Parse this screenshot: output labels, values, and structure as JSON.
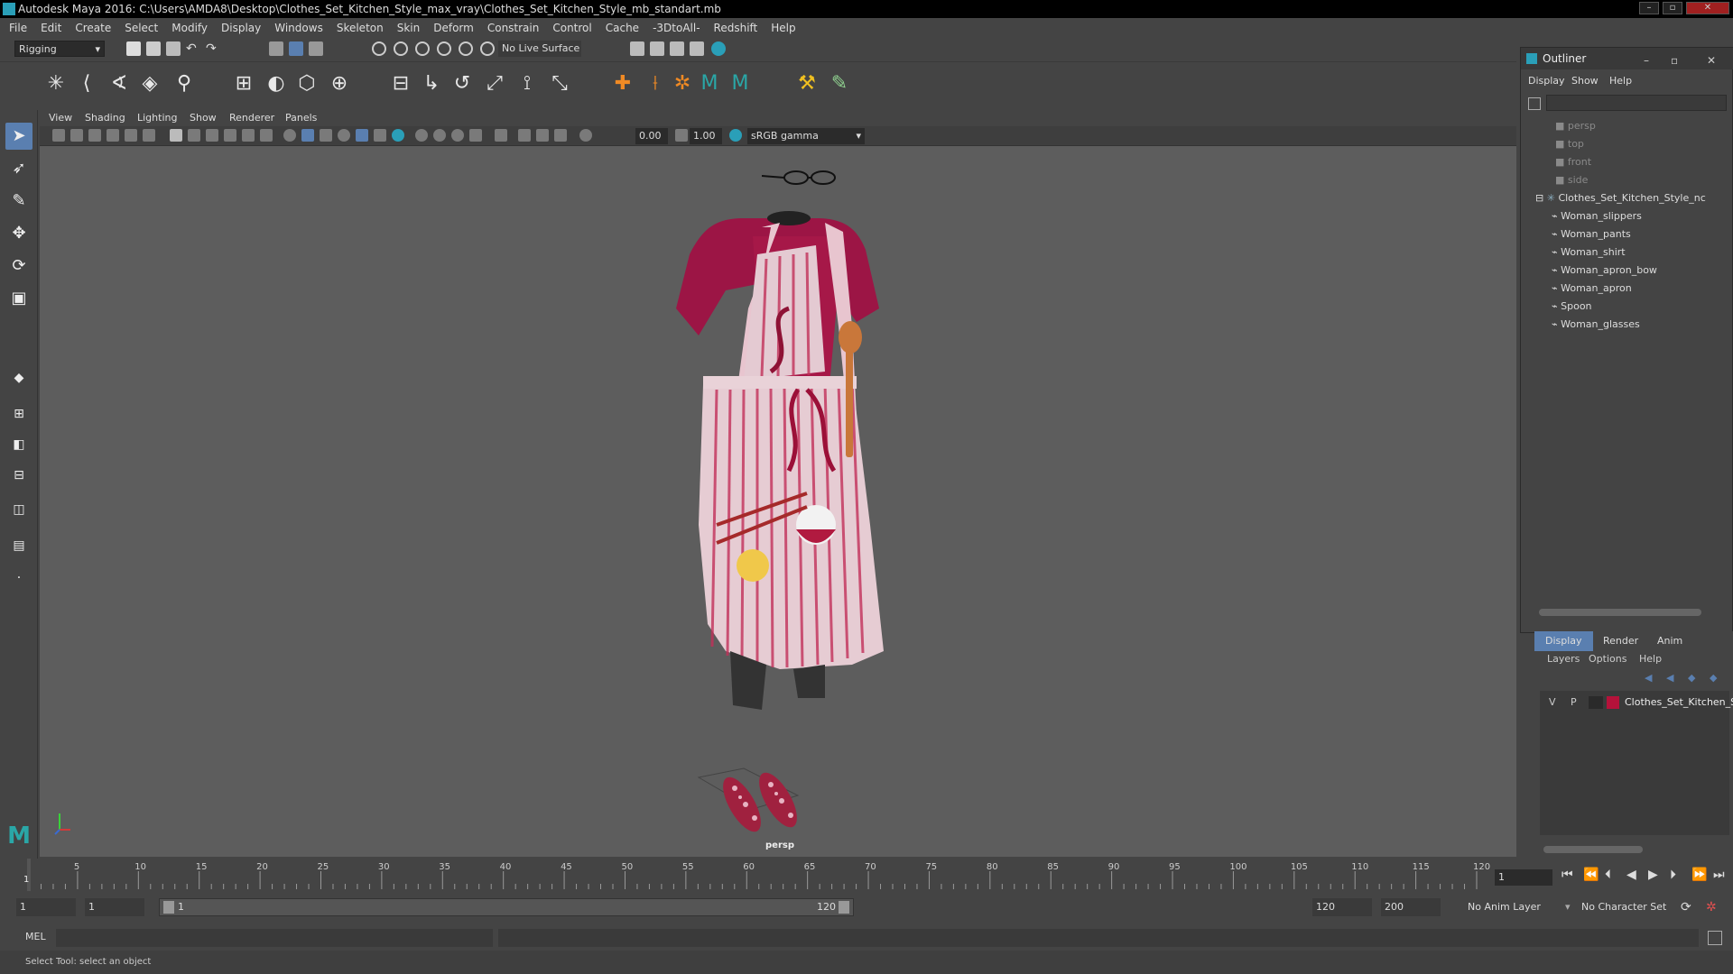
{
  "window": {
    "title": "Autodesk Maya 2016: C:\\Users\\AMDA8\\Desktop\\Clothes_Set_Kitchen_Style_max_vray\\Clothes_Set_Kitchen_Style_mb_standart.mb"
  },
  "menubar": [
    "File",
    "Edit",
    "Create",
    "Select",
    "Modify",
    "Display",
    "Windows",
    "Skeleton",
    "Skin",
    "Deform",
    "Constrain",
    "Control",
    "Cache",
    "-3DtoAll-",
    "Redshift",
    "Help"
  ],
  "statusline": {
    "mode": "Rigging",
    "live_surface": "No Live Surface"
  },
  "viewport": {
    "menus": [
      "View",
      "Shading",
      "Lighting",
      "Show",
      "Renderer",
      "Panels"
    ],
    "exposure": "0.00",
    "gamma": "1.00",
    "color_space": "sRGB gamma",
    "camera_label": "persp"
  },
  "outliner": {
    "title": "Outliner",
    "menus": [
      "Display",
      "Show",
      "Help"
    ],
    "cameras": [
      "persp",
      "top",
      "front",
      "side"
    ],
    "root": "Clothes_Set_Kitchen_Style_nc",
    "children": [
      "Woman_slippers",
      "Woman_pants",
      "Woman_shirt",
      "Woman_apron_bow",
      "Woman_apron",
      "Spoon",
      "Woman_glasses"
    ]
  },
  "layer_editor": {
    "tabs": [
      "Display",
      "Render",
      "Anim"
    ],
    "menus": [
      "Layers",
      "Options",
      "Help"
    ],
    "layer": {
      "v": "V",
      "p": "P",
      "name": "Clothes_Set_Kitchen_S",
      "color": "#b5123a"
    }
  },
  "timeslider": {
    "ticks": [
      "5",
      "10",
      "15",
      "20",
      "25",
      "30",
      "35",
      "40",
      "45",
      "50",
      "55",
      "60",
      "65",
      "70",
      "75",
      "80",
      "85",
      "90",
      "95",
      "100",
      "105",
      "110",
      "115",
      "120"
    ],
    "current_frame_marker": "1",
    "current_frame": "1"
  },
  "range": {
    "start": "1",
    "playback_start": "1",
    "slider_start": "1",
    "slider_end": "120",
    "playback_end": "120",
    "end": "200",
    "anim_layer": "No Anim Layer",
    "character_set": "No Character Set"
  },
  "cmdline": {
    "label": "MEL"
  },
  "helpline": {
    "text": "Select Tool: select an object"
  }
}
